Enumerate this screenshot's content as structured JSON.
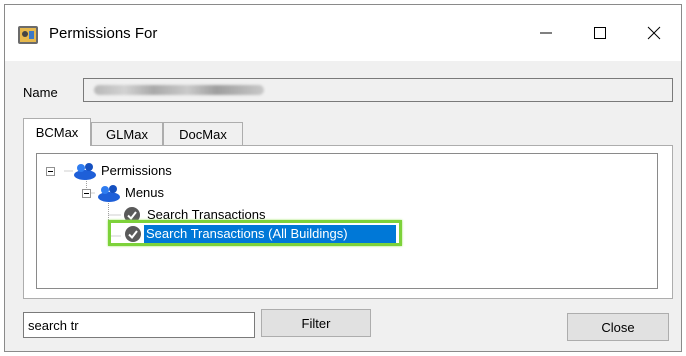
{
  "window": {
    "title": "Permissions For"
  },
  "form": {
    "name_label": "Name",
    "name_value_redacted": true
  },
  "tabs": [
    {
      "label": "BCMax",
      "active": true
    },
    {
      "label": "GLMax",
      "active": false
    },
    {
      "label": "DocMax",
      "active": false
    }
  ],
  "tree": {
    "root": {
      "label": "Permissions",
      "icon": "users-icon",
      "expanded": true
    },
    "menus": {
      "label": "Menus",
      "icon": "users-icon",
      "expanded": true
    },
    "items": [
      {
        "label": "Search Transactions",
        "icon": "check-circle-icon",
        "selected": false
      },
      {
        "label": "Search Transactions (All Buildings)",
        "icon": "check-circle-icon",
        "selected": true
      }
    ]
  },
  "filter": {
    "value": "search tr",
    "button_label": "Filter"
  },
  "close_label": "Close",
  "colors": {
    "selection": "#0078d7",
    "highlight_border": "#7dd23a",
    "window_bg": "#f0f0f0"
  }
}
